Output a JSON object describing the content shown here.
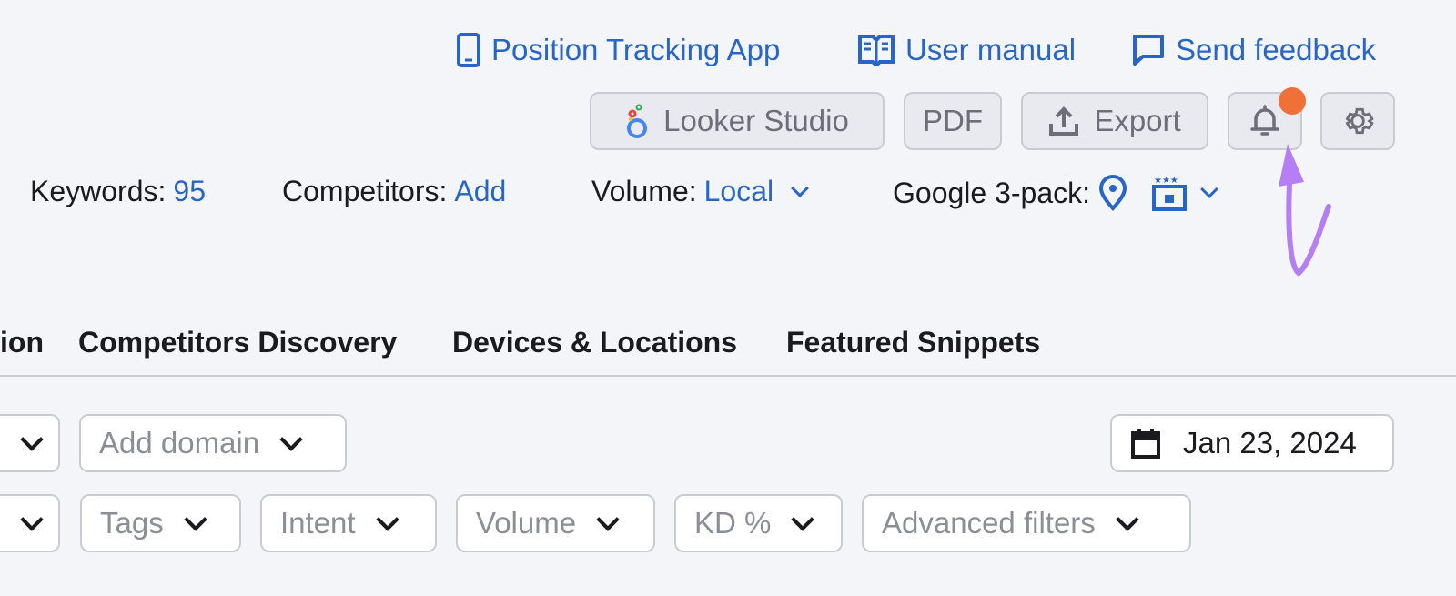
{
  "header_links": [
    {
      "label": "Position Tracking App",
      "icon": "mobile-icon"
    },
    {
      "label": "User manual",
      "icon": "book-icon"
    },
    {
      "label": "Send feedback",
      "icon": "chat-icon"
    }
  ],
  "buttons": {
    "looker": "Looker Studio",
    "pdf": "PDF",
    "export": "Export"
  },
  "meta": {
    "keywords_label": "Keywords:",
    "keywords_value": "95",
    "competitors_label": "Competitors:",
    "competitors_value": "Add",
    "volume_label": "Volume:",
    "volume_value": "Local",
    "pack_label": "Google 3-pack:"
  },
  "tabs": [
    "ion",
    "Competitors Discovery",
    "Devices & Locations",
    "Featured Snippets"
  ],
  "filters": {
    "add_domain": "Add domain",
    "date": "Jan 23, 2024",
    "tags": "Tags",
    "intent": "Intent",
    "volume": "Volume",
    "kd": "KD %",
    "advanced": "Advanced filters"
  },
  "colors": {
    "accent": "#2766c8",
    "notification": "#f07038",
    "annotation": "#b57ef5"
  }
}
